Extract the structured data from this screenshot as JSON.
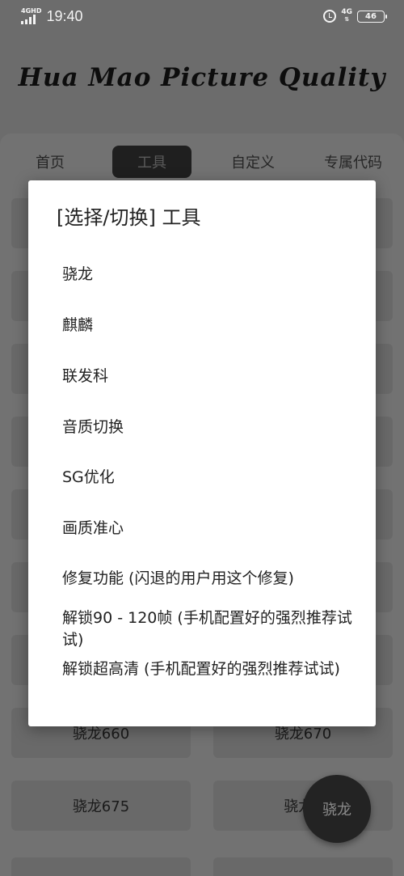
{
  "status_bar": {
    "network_tag": "4GHD",
    "time": "19:40",
    "network_right": "4G",
    "battery": "46"
  },
  "app": {
    "title": "Hua Mao Picture Quality"
  },
  "tabs": [
    {
      "label": "首页"
    },
    {
      "label": "工具"
    },
    {
      "label": "自定义"
    },
    {
      "label": "专属代码"
    }
  ],
  "grid_visible": [
    {
      "label": "骁龙660"
    },
    {
      "label": "骁龙670"
    },
    {
      "label": "骁龙675"
    },
    {
      "label": "骁龙7"
    }
  ],
  "fab": {
    "label": "骁龙"
  },
  "dialog": {
    "title": "[选择/切换] 工具",
    "options": [
      {
        "label": "骁龙"
      },
      {
        "label": "麒麟"
      },
      {
        "label": "联发科"
      },
      {
        "label": "音质切换"
      },
      {
        "label": "SG优化"
      },
      {
        "label": "画质准心"
      },
      {
        "label": "修复功能 (闪退的用户用这个修复)"
      },
      {
        "label": "解锁90 - 120帧 (手机配置好的强烈推荐试试)"
      },
      {
        "label": "解锁超高清 (手机配置好的强烈推荐试试)"
      }
    ]
  }
}
